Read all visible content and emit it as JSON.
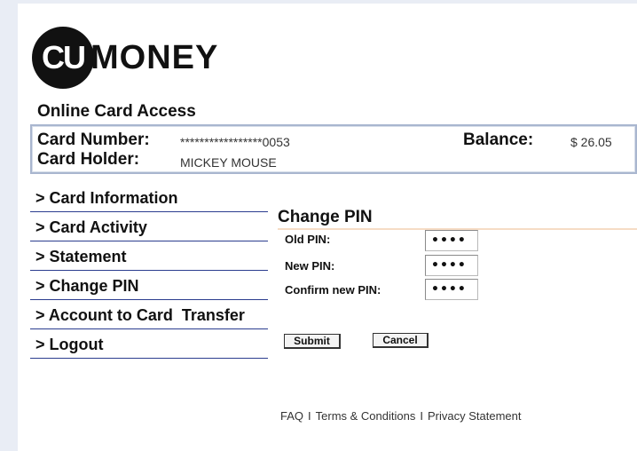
{
  "brand": {
    "logo_cu": "CU",
    "logo_rest": "MONEY"
  },
  "section_title": "Online Card Access",
  "card": {
    "number_label": "Card Number:",
    "number_value": "*****************0053",
    "holder_label": "Card Holder:",
    "holder_value": "MICKEY MOUSE",
    "balance_label": "Balance:",
    "balance_value": "$ 26.05"
  },
  "nav": {
    "items": [
      {
        "label": "> Card Information"
      },
      {
        "label": "> Card Activity"
      },
      {
        "label": "> Statement"
      },
      {
        "label": "> Change PIN"
      },
      {
        "label": "> Account to Card  Transfer"
      },
      {
        "label": "> Logout"
      }
    ]
  },
  "form": {
    "title": "Change PIN",
    "old_label": "Old PIN:",
    "old_value": "••••",
    "new_label": "New PIN:",
    "new_value": "••••",
    "confirm_label": "Confirm new PIN:",
    "confirm_value": "••••",
    "submit_label": "Submit",
    "cancel_label": "Cancel"
  },
  "footer": {
    "faq": "FAQ",
    "terms": "Terms & Conditions",
    "privacy": "Privacy Statement",
    "separator": "I"
  }
}
